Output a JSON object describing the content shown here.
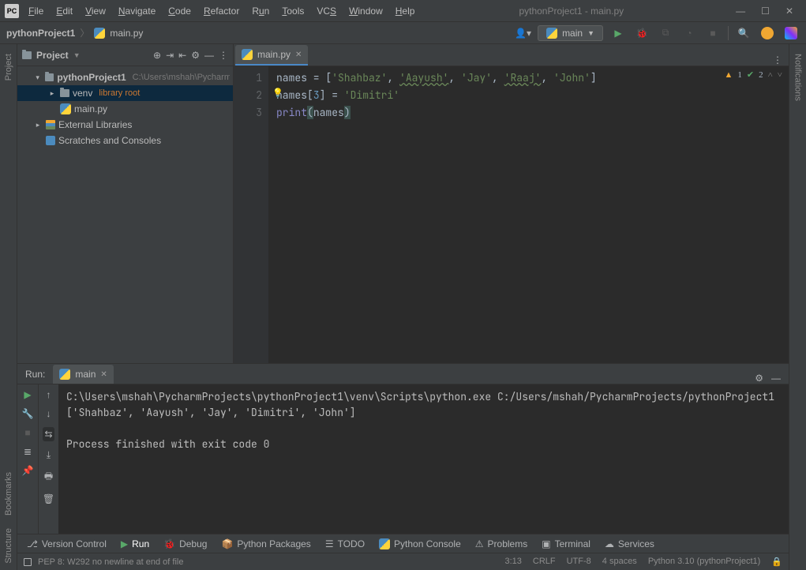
{
  "title": "pythonProject1 - main.py",
  "menu": [
    "File",
    "Edit",
    "View",
    "Navigate",
    "Code",
    "Refactor",
    "Run",
    "Tools",
    "VCS",
    "Window",
    "Help"
  ],
  "breadcrumb": {
    "project": "pythonProject1",
    "file": "main.py"
  },
  "runConfig": "main",
  "projectTree": {
    "header": "Project",
    "root": "pythonProject1",
    "rootPath": "C:\\Users\\mshah\\PycharmP",
    "venv": "venv",
    "venvTag": "library root",
    "mainpy": "main.py",
    "extLib": "External Libraries",
    "scratches": "Scratches and Consoles"
  },
  "editor": {
    "tab": "main.py",
    "ln": [
      "1",
      "2",
      "3"
    ],
    "problems": {
      "warn": "1",
      "ok": "2"
    }
  },
  "code": {
    "names": "names = [",
    "s1": "'Shahbaz'",
    "s2": "'Aayush'",
    "s3": "'Jay'",
    "s4": "'Raaj'",
    "s5": "'John'",
    "close": "]",
    "l2a": "names[",
    "l2n": "3",
    "l2b": "] = ",
    "l2s": "'Dimitri'",
    "l3fn": "print",
    "l3a": "(",
    "l3v": "names",
    "l3b": ")"
  },
  "run": {
    "title": "Run:",
    "tab": "main",
    "out1": "C:\\Users\\mshah\\PycharmProjects\\pythonProject1\\venv\\Scripts\\python.exe C:/Users/mshah/PycharmProjects/pythonProject1",
    "out2": "['Shahbaz', 'Aayush', 'Jay', 'Dimitri', 'John']",
    "out3": "",
    "out4": "Process finished with exit code 0"
  },
  "bottomTools": {
    "vcs": "Version Control",
    "run": "Run",
    "debug": "Debug",
    "pkg": "Python Packages",
    "todo": "TODO",
    "console": "Python Console",
    "problems": "Problems",
    "terminal": "Terminal",
    "services": "Services"
  },
  "status": {
    "msg": "PEP 8: W292 no newline at end of file",
    "pos": "3:13",
    "le": "CRLF",
    "enc": "UTF-8",
    "indent": "4 spaces",
    "interp": "Python 3.10 (pythonProject1)"
  },
  "sidebars": {
    "project": "Project",
    "bookmarks": "Bookmarks",
    "structure": "Structure",
    "notifications": "Notifications"
  }
}
